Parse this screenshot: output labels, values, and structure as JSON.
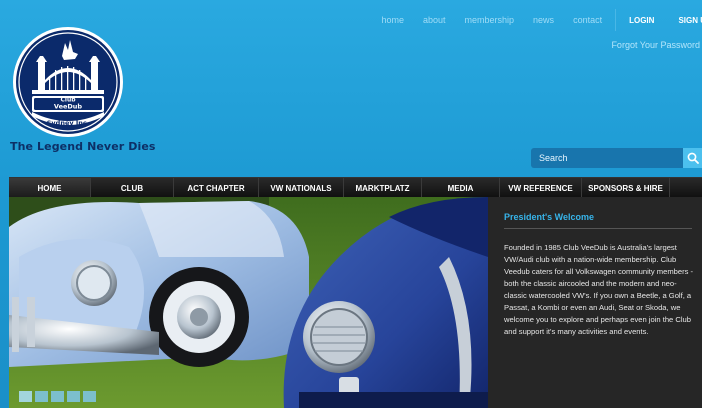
{
  "top_nav": {
    "links": [
      "home",
      "about",
      "membership",
      "news",
      "contact"
    ],
    "login": "LOGIN",
    "signup": "SIGN U",
    "forgot": "Forgot Your Password"
  },
  "logo": {
    "text_line1": "Club",
    "text_line2": "VeeDub",
    "text_line3": "Sydney Inc."
  },
  "tagline": "The Legend Never Dies",
  "search": {
    "placeholder": "Search"
  },
  "main_nav": {
    "items": [
      "HOME",
      "CLUB",
      "ACT CHAPTER",
      "VW NATIONALS",
      "MARKTPLATZ",
      "MEDIA",
      "VW REFERENCE",
      "SPONSORS & HIRE"
    ],
    "active_index": 0
  },
  "hero": {
    "slide_count": 5,
    "active_slide": 1
  },
  "welcome": {
    "title": "President's Welcome",
    "body": "Founded in 1985 Club VeeDub is Australia's largest VW/Audi club with a nation-wide membership.  Club Veedub caters for all Volkswagen community members - both the classic aircooled and the modern and neo-classic watercooled VW's. If you own a Beetle, a Golf, a Passat, a Kombi or even an Audi, Seat or Skoda, we welcome you to explore and perhaps even join the Club and support it's many activities and events."
  },
  "colors": {
    "background": "#1f9fd8",
    "nav_bar": "#141414",
    "accent": "#37b4ea",
    "tagline": "#0d2f66",
    "logo_navy": "#0b2a6b"
  }
}
